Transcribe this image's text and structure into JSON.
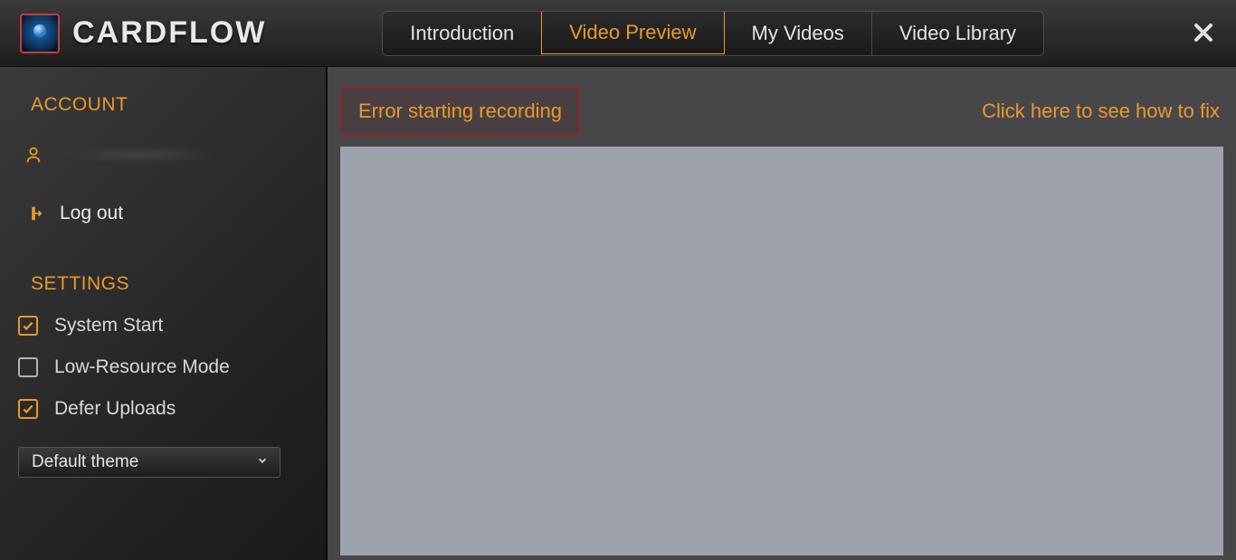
{
  "app": {
    "name": "CARDFLOW"
  },
  "header": {
    "tabs": [
      {
        "label": "Introduction",
        "active": false
      },
      {
        "label": "Video Preview",
        "active": true
      },
      {
        "label": "My Videos",
        "active": false
      },
      {
        "label": "Video Library",
        "active": false
      }
    ]
  },
  "sidebar": {
    "account_title": "ACCOUNT",
    "logout_label": "Log out",
    "settings_title": "SETTINGS",
    "settings": [
      {
        "label": "System Start",
        "checked": true
      },
      {
        "label": "Low-Resource Mode",
        "checked": false
      },
      {
        "label": "Defer Uploads",
        "checked": true
      }
    ],
    "theme_selected": "Default theme"
  },
  "content": {
    "error_message": "Error starting recording",
    "fix_link": "Click here to see how to fix"
  },
  "colors": {
    "accent": "#e79a2d",
    "error_border": "#8a2a2a"
  }
}
